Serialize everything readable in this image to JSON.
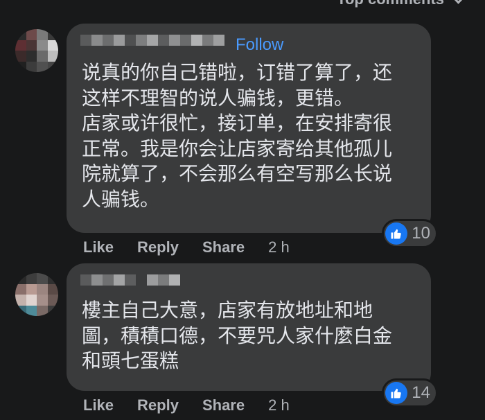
{
  "header": {
    "sort_label": "Top comments"
  },
  "comments": [
    {
      "follow_label": "Follow",
      "text": "说真的你自己错啦，订错了算了，还\n这样不理智的说人骗钱，更错。\n店家或许很忙，接订单，在安排寄很\n正常。我是你会让店家寄给其他孤儿\n院就算了，不会那么有空写那么长说\n人骗钱。",
      "reaction_count": "10",
      "like_label": "Like",
      "reply_label": "Reply",
      "share_label": "Share",
      "time": "2 h"
    },
    {
      "text": "樓主自己大意，店家有放地址和地\n圖，積積口德，不要咒人家什麼白金\n和頭七蛋糕",
      "reaction_count": "14",
      "like_label": "Like",
      "reply_label": "Reply",
      "share_label": "Share",
      "time": "2 h"
    }
  ],
  "colors": {
    "background": "#18191a",
    "bubble": "#3a3b3c",
    "accent": "#4a9bff",
    "like_badge": "#1877f2"
  },
  "icons": {
    "reaction": "thumbs-up-icon",
    "sort": "chevron-down-icon"
  }
}
